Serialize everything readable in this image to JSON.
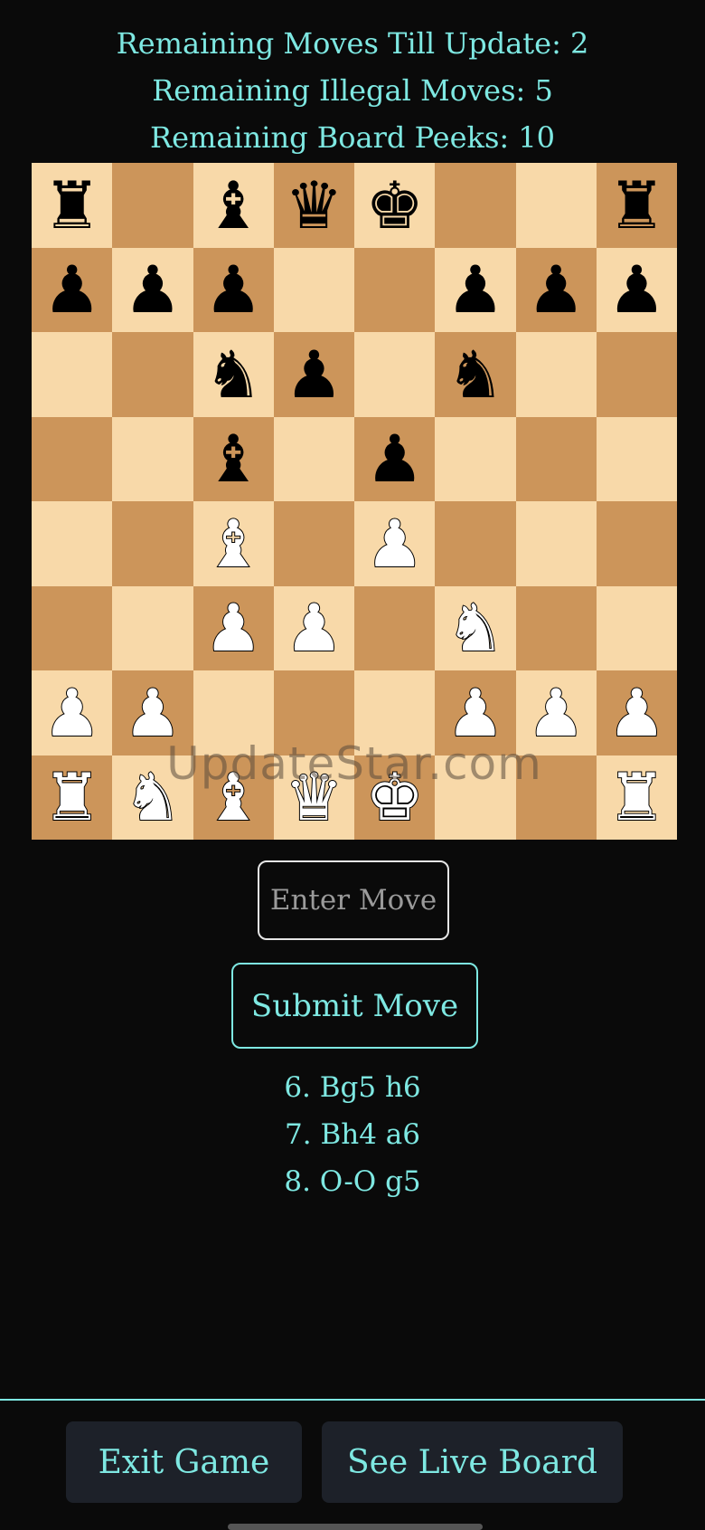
{
  "status": {
    "moves_till_update": "Remaining Moves Till Update: 2",
    "illegal_moves": "Remaining Illegal Moves: 5",
    "board_peeks": "Remaining Board Peeks: 10"
  },
  "board": {
    "rows": [
      [
        {
          "g": "♜",
          "c": "black"
        },
        {
          "g": "",
          "c": ""
        },
        {
          "g": "♝",
          "c": "black"
        },
        {
          "g": "♛",
          "c": "black"
        },
        {
          "g": "♚",
          "c": "black"
        },
        {
          "g": "",
          "c": ""
        },
        {
          "g": "",
          "c": ""
        },
        {
          "g": "♜",
          "c": "black"
        }
      ],
      [
        {
          "g": "♟",
          "c": "black"
        },
        {
          "g": "♟",
          "c": "black"
        },
        {
          "g": "♟",
          "c": "black"
        },
        {
          "g": "",
          "c": ""
        },
        {
          "g": "",
          "c": ""
        },
        {
          "g": "♟",
          "c": "black"
        },
        {
          "g": "♟",
          "c": "black"
        },
        {
          "g": "♟",
          "c": "black"
        }
      ],
      [
        {
          "g": "",
          "c": ""
        },
        {
          "g": "",
          "c": ""
        },
        {
          "g": "♞",
          "c": "black"
        },
        {
          "g": "♟",
          "c": "black"
        },
        {
          "g": "",
          "c": ""
        },
        {
          "g": "♞",
          "c": "black"
        },
        {
          "g": "",
          "c": ""
        },
        {
          "g": "",
          "c": ""
        }
      ],
      [
        {
          "g": "",
          "c": ""
        },
        {
          "g": "",
          "c": ""
        },
        {
          "g": "♝",
          "c": "black"
        },
        {
          "g": "",
          "c": ""
        },
        {
          "g": "♟",
          "c": "black"
        },
        {
          "g": "",
          "c": ""
        },
        {
          "g": "",
          "c": ""
        },
        {
          "g": "",
          "c": ""
        }
      ],
      [
        {
          "g": "",
          "c": ""
        },
        {
          "g": "",
          "c": ""
        },
        {
          "g": "♝",
          "c": "white"
        },
        {
          "g": "",
          "c": ""
        },
        {
          "g": "♟",
          "c": "white"
        },
        {
          "g": "",
          "c": ""
        },
        {
          "g": "",
          "c": ""
        },
        {
          "g": "",
          "c": ""
        }
      ],
      [
        {
          "g": "",
          "c": ""
        },
        {
          "g": "",
          "c": ""
        },
        {
          "g": "♟",
          "c": "white"
        },
        {
          "g": "♟",
          "c": "white"
        },
        {
          "g": "",
          "c": ""
        },
        {
          "g": "♞",
          "c": "white"
        },
        {
          "g": "",
          "c": ""
        },
        {
          "g": "",
          "c": ""
        }
      ],
      [
        {
          "g": "♟",
          "c": "white"
        },
        {
          "g": "♟",
          "c": "white"
        },
        {
          "g": "",
          "c": ""
        },
        {
          "g": "",
          "c": ""
        },
        {
          "g": "",
          "c": ""
        },
        {
          "g": "♟",
          "c": "white"
        },
        {
          "g": "♟",
          "c": "white"
        },
        {
          "g": "♟",
          "c": "white"
        }
      ],
      [
        {
          "g": "♜",
          "c": "white"
        },
        {
          "g": "♞",
          "c": "white"
        },
        {
          "g": "♝",
          "c": "white"
        },
        {
          "g": "♛",
          "c": "white"
        },
        {
          "g": "♚",
          "c": "white"
        },
        {
          "g": "",
          "c": ""
        },
        {
          "g": "",
          "c": ""
        },
        {
          "g": "♜",
          "c": "white"
        }
      ]
    ],
    "light_color": "#f8d9a9",
    "dark_color": "#cc955a"
  },
  "watermark": "UpdateStar.com",
  "move_input": {
    "placeholder": "Enter Move",
    "value": ""
  },
  "submit_label": "Submit Move",
  "history": [
    "6. Bg5 h6",
    "7. Bh4 a6",
    "8. O-O g5"
  ],
  "footer": {
    "exit_label": "Exit Game",
    "live_board_label": "See Live Board"
  },
  "colors": {
    "accent": "#7ee8e2",
    "background": "#0a0a0a",
    "button_bg": "#1d2129"
  }
}
